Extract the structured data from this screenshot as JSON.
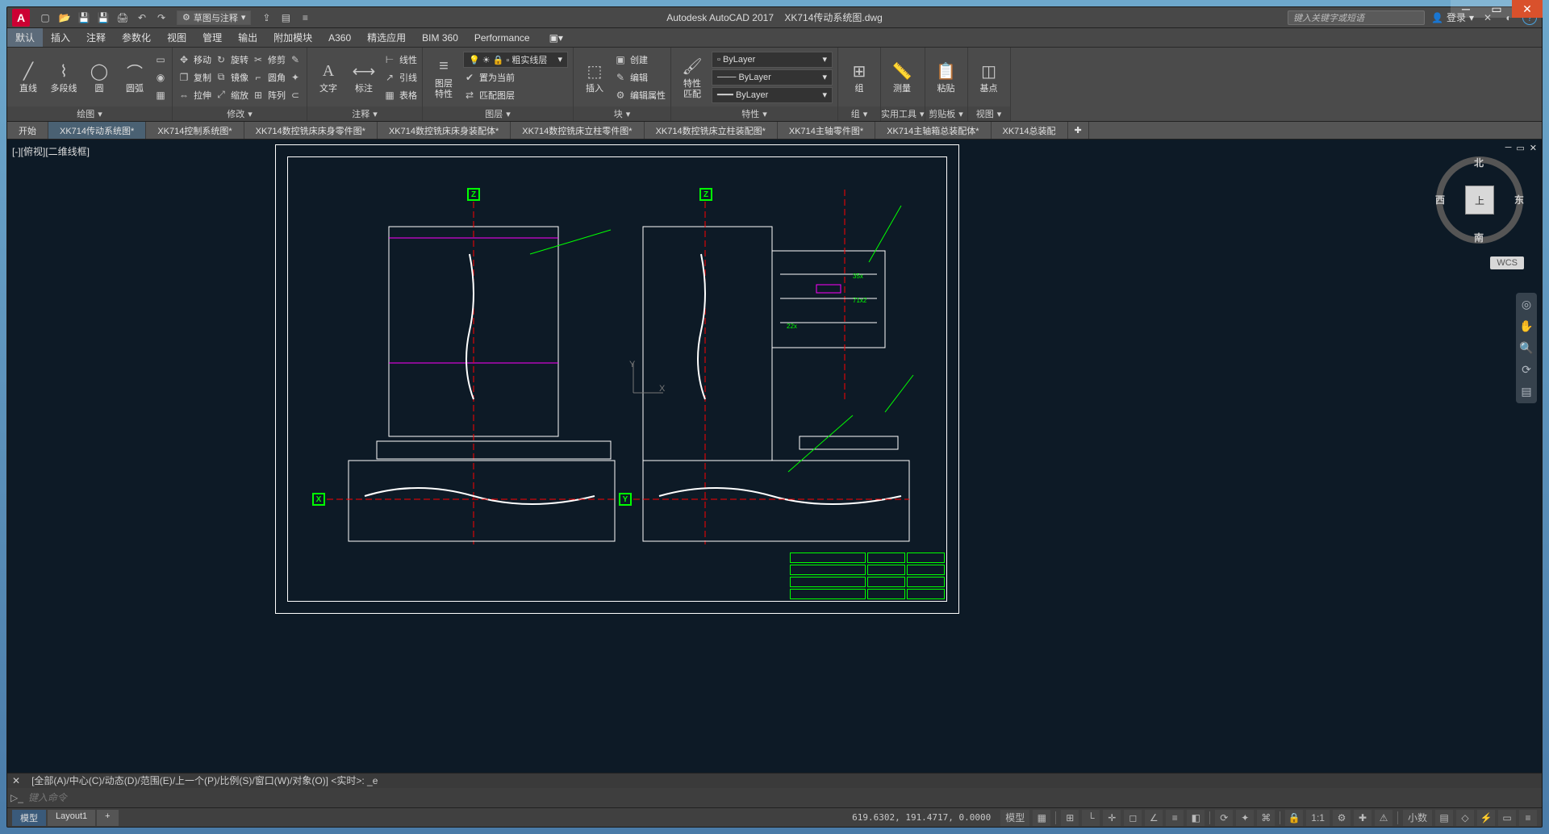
{
  "title": {
    "app": "Autodesk AutoCAD 2017",
    "doc": "XK714传动系统图.dwg"
  },
  "logo": "A",
  "search_placeholder": "键入关键字或短语",
  "login": "登录",
  "workspace": "草图与注释",
  "menu_tabs": [
    "默认",
    "插入",
    "注释",
    "参数化",
    "视图",
    "管理",
    "输出",
    "附加模块",
    "A360",
    "精选应用",
    "BIM 360",
    "Performance"
  ],
  "qat_icons": [
    "new",
    "open",
    "save",
    "saveas",
    "plot",
    "undo",
    "redo"
  ],
  "ribbon": {
    "draw": {
      "title": "绘图",
      "line": "直线",
      "pline": "多段线",
      "circle": "圆",
      "arc": "圆弧"
    },
    "modify": {
      "title": "修改",
      "move": "移动",
      "rotate": "旋转",
      "trim": "修剪",
      "copy": "复制",
      "mirror": "镜像",
      "fillet": "圆角",
      "stretch": "拉伸",
      "scale": "缩放",
      "array": "阵列"
    },
    "annot": {
      "title": "注释",
      "text": "文字",
      "dim": "标注",
      "line": "线性",
      "leader": "引线",
      "table": "表格"
    },
    "layers": {
      "title": "图层",
      "btn": "图层\n特性",
      "cur": "粗实线层",
      "make": "置为当前",
      "match": "匹配图层"
    },
    "block": {
      "title": "块",
      "insert": "插入",
      "create": "创建",
      "edit": "编辑",
      "editattr": "编辑属性"
    },
    "props": {
      "title": "特性",
      "btn": "特性\n匹配",
      "color": "ByLayer",
      "ltype": "ByLayer",
      "lweight": "ByLayer"
    },
    "group": {
      "title": "组",
      "btn": "组"
    },
    "utils": {
      "title": "实用工具",
      "btn": "测量"
    },
    "clip": {
      "title": "剪贴板",
      "btn": "粘贴"
    },
    "view": {
      "title": "视图",
      "btn": "基点"
    }
  },
  "doc_tabs": [
    "开始",
    "XK714传动系统图*",
    "XK714控制系统图*",
    "XK714数控铣床床身零件图*",
    "XK714数控铣床床身装配体*",
    "XK714数控铣床立柱零件图*",
    "XK714数控铣床立柱装配图*",
    "XK714主轴零件图*",
    "XK714主轴箱总装配体*",
    "XK714总装配"
  ],
  "vp_label": "[-][俯视][二维线框]",
  "viewcube": {
    "top": "北",
    "bottom": "南",
    "left": "西",
    "right": "东",
    "face": "上"
  },
  "wcs": "WCS",
  "ucs": {
    "x": "X",
    "y": "Y"
  },
  "axes": {
    "z": "Z",
    "x": "X",
    "y": "Y"
  },
  "cmd_history": "[全部(A)/中心(C)/动态(D)/范围(E)/上一个(P)/比例(S)/窗口(W)/对象(O)] <实时>: _e",
  "cmd_prompt": "键入命令",
  "layout_tabs": [
    "模型",
    "Layout1"
  ],
  "coords": "619.6302, 191.4717, 0.0000",
  "status_equal": "模型",
  "scale": "1:1",
  "dec": "小数"
}
